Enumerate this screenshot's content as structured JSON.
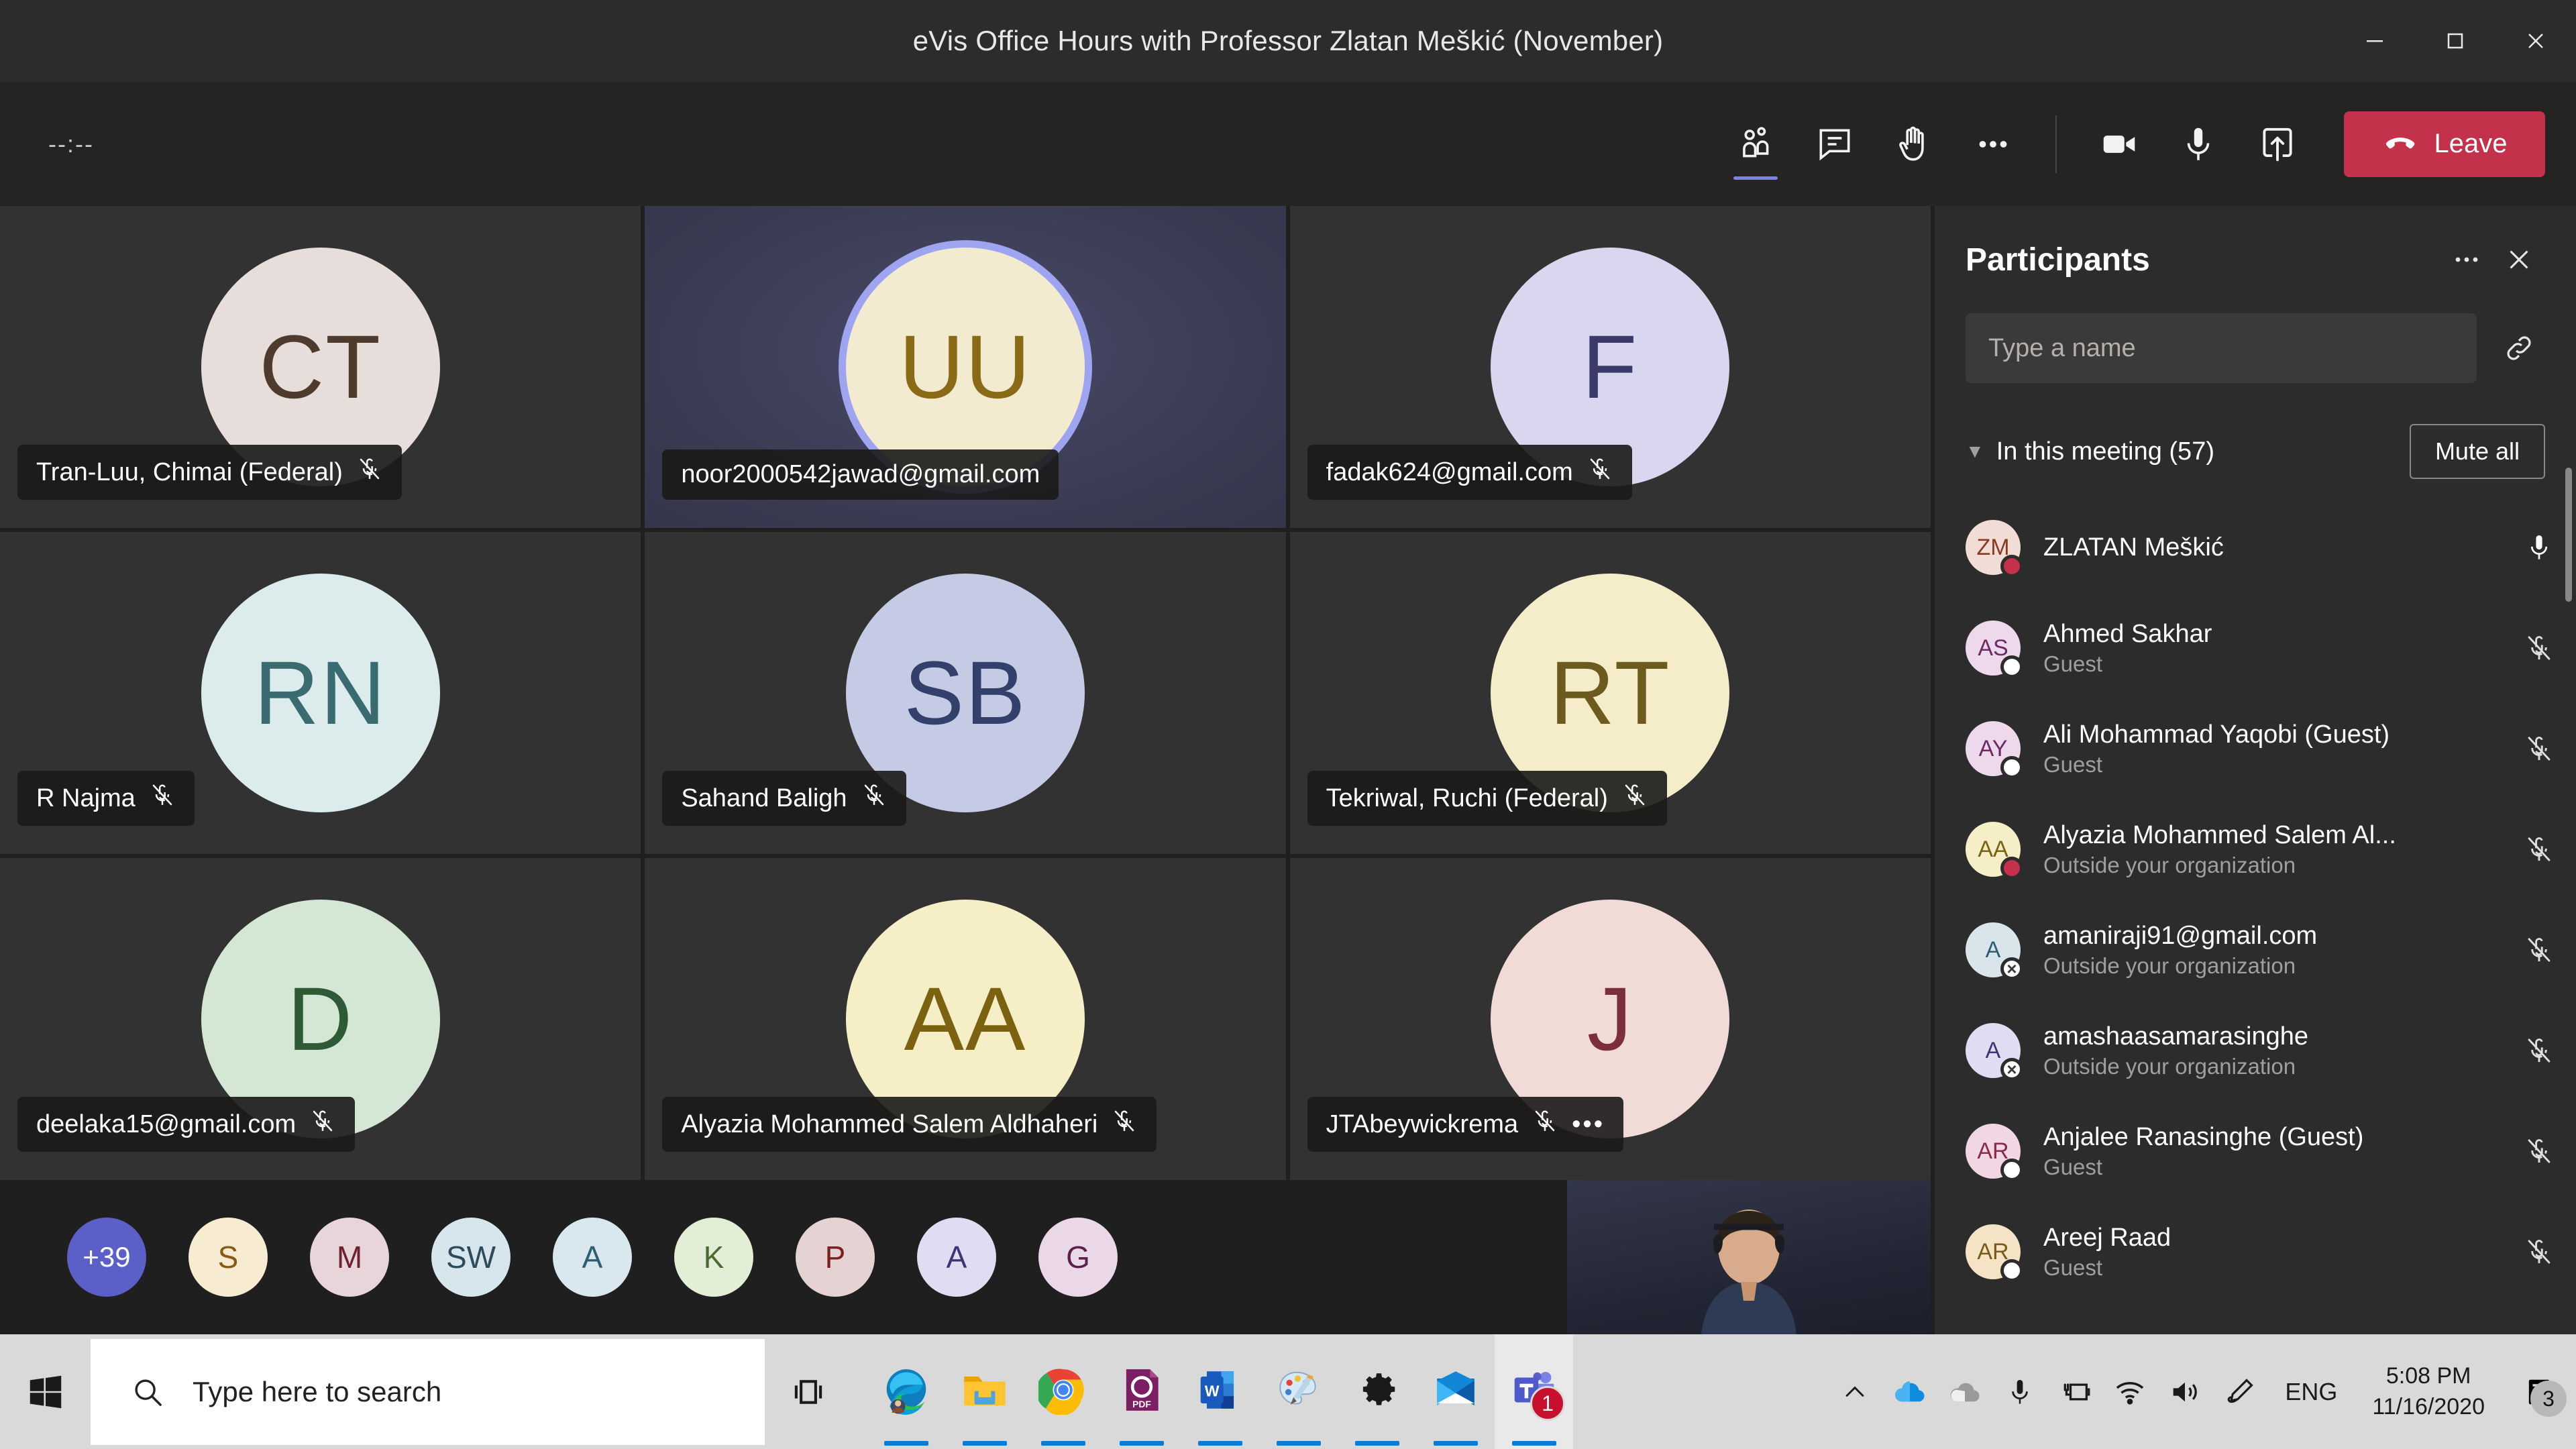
{
  "window": {
    "title": "eVis Office Hours with Professor Zlatan Meškić (November)",
    "minimize_label": "Minimize",
    "maximize_label": "Maximize",
    "close_label": "Close"
  },
  "toolbar": {
    "timer": "--:--",
    "people_label": "Show participants",
    "chat_label": "Show conversation",
    "raise_hand_label": "Raise your hand",
    "more_label": "More actions",
    "camera_label": "Turn camera on",
    "mic_label": "Mute",
    "share_label": "Share content",
    "leave_label": "Leave"
  },
  "stage": {
    "tiles": [
      {
        "initials": "CT",
        "name": "Tran-Luu, Chimai (Federal)",
        "bg": "#e7dedb",
        "fg": "#4f3a2e",
        "muted": true,
        "speaking": false,
        "more": false
      },
      {
        "initials": "UU",
        "name": "noor2000542jawad@gmail.com",
        "bg": "#f2ebd0",
        "fg": "#8a6a16",
        "muted": false,
        "speaking": true,
        "more": false
      },
      {
        "initials": "F",
        "name": "fadak624@gmail.com",
        "bg": "#d8d7ef",
        "fg": "#3b3b6b",
        "muted": true,
        "speaking": false,
        "more": false
      },
      {
        "initials": "RN",
        "name": "R Najma",
        "bg": "#dcebec",
        "fg": "#3a6b70",
        "muted": true,
        "speaking": false,
        "more": false
      },
      {
        "initials": "SB",
        "name": "Sahand Baligh",
        "bg": "#c6cbe5",
        "fg": "#33406b",
        "muted": true,
        "speaking": false,
        "more": false
      },
      {
        "initials": "RT",
        "name": "Tekriwal, Ruchi (Federal)",
        "bg": "#f5ecc9",
        "fg": "#6d5a1e",
        "muted": true,
        "speaking": false,
        "more": false
      },
      {
        "initials": "D",
        "name": "deelaka15@gmail.com",
        "bg": "#d4e6d4",
        "fg": "#2f5a36",
        "muted": true,
        "speaking": false,
        "more": false
      },
      {
        "initials": "AA",
        "name": "Alyazia Mohammed Salem Aldhaheri",
        "bg": "#f6eec6",
        "fg": "#7a6210",
        "muted": true,
        "speaking": false,
        "more": false
      },
      {
        "initials": "J",
        "name": "JTAbeywickrema",
        "bg": "#f0dbd7",
        "fg": "#7b2f3a",
        "muted": true,
        "speaking": false,
        "more": true
      }
    ],
    "overflow": [
      {
        "initials": "+39",
        "bg": "#5b5fc7",
        "fg": "#ffffff",
        "more": true
      },
      {
        "initials": "S",
        "bg": "#f7ebd2",
        "fg": "#8a5a14",
        "more": false
      },
      {
        "initials": "M",
        "bg": "#e7d5da",
        "fg": "#6e2230",
        "more": false
      },
      {
        "initials": "SW",
        "bg": "#d7e5ec",
        "fg": "#2f4a58",
        "more": false
      },
      {
        "initials": "A",
        "bg": "#d9e8ef",
        "fg": "#2f5d72",
        "more": false
      },
      {
        "initials": "K",
        "bg": "#e2eed6",
        "fg": "#4c6b32",
        "more": false
      },
      {
        "initials": "P",
        "bg": "#e5d3d3",
        "fg": "#7b2020",
        "more": false
      },
      {
        "initials": "A",
        "bg": "#e0dcf1",
        "fg": "#3d3576",
        "more": false
      },
      {
        "initials": "G",
        "bg": "#ead7e7",
        "fg": "#5d1f4b",
        "more": false
      }
    ],
    "selfview_label": "Your video"
  },
  "panel": {
    "title": "Participants",
    "more_label": "More options",
    "close_label": "Close participants pane",
    "search_placeholder": "Type a name",
    "search_value": "",
    "invite_link_label": "Share invite link",
    "section_label": "In this meeting (57)",
    "mute_all_label": "Mute all",
    "participants": [
      {
        "initials": "ZM",
        "name": "ZLATAN Meškić",
        "sub": "",
        "bg": "#f2ddd6",
        "fg": "#8a3a22",
        "presence": "busy",
        "muted": false
      },
      {
        "initials": "AS",
        "name": "Ahmed Sakhar",
        "sub": "Guest",
        "bg": "#eed9ec",
        "fg": "#6b2a63",
        "presence": "away",
        "muted": true
      },
      {
        "initials": "AY",
        "name": "Ali Mohammad Yaqobi (Guest)",
        "sub": "Guest",
        "bg": "#eed9ec",
        "fg": "#6b2a63",
        "presence": "away",
        "muted": true
      },
      {
        "initials": "AA",
        "name": "Alyazia Mohammed Salem Al...",
        "sub": "Outside your organization",
        "bg": "#f6eec6",
        "fg": "#7a6210",
        "presence": "busy",
        "muted": true
      },
      {
        "initials": "A",
        "name": "amaniraji91@gmail.com",
        "sub": "Outside your organization",
        "bg": "#d9e5ea",
        "fg": "#2f5d72",
        "presence": "offline",
        "muted": true
      },
      {
        "initials": "A",
        "name": "amashaasamarasinghe",
        "sub": "Outside your organization",
        "bg": "#e0dcf1",
        "fg": "#3d3576",
        "presence": "offline",
        "muted": true
      },
      {
        "initials": "AR",
        "name": "Anjalee Ranasinghe (Guest)",
        "sub": "Guest",
        "bg": "#f0d7e3",
        "fg": "#8a2a4b",
        "presence": "away",
        "muted": true
      },
      {
        "initials": "AR",
        "name": "Areej Raad",
        "sub": "Guest",
        "bg": "#f5e3c6",
        "fg": "#7a5a1a",
        "presence": "away",
        "muted": true
      }
    ]
  },
  "taskbar": {
    "start_label": "Start",
    "search_placeholder": "Type here to search",
    "task_view_label": "Task view",
    "apps": [
      {
        "name": "Microsoft Edge",
        "running": true,
        "focused": false,
        "badge": ""
      },
      {
        "name": "File Explorer",
        "running": true,
        "focused": false,
        "badge": ""
      },
      {
        "name": "Google Chrome",
        "running": true,
        "focused": false,
        "badge": ""
      },
      {
        "name": "Foxit PDF Reader",
        "running": true,
        "focused": false,
        "badge": ""
      },
      {
        "name": "Microsoft Word",
        "running": true,
        "focused": false,
        "badge": ""
      },
      {
        "name": "Paint 3D",
        "running": true,
        "focused": false,
        "badge": ""
      },
      {
        "name": "Settings",
        "running": true,
        "focused": false,
        "badge": ""
      },
      {
        "name": "Mail",
        "running": true,
        "focused": false,
        "badge": ""
      },
      {
        "name": "Microsoft Teams",
        "running": true,
        "focused": true,
        "badge": "1"
      }
    ],
    "tray": {
      "show_hidden_label": "Show hidden icons",
      "onedrive_personal_label": "OneDrive",
      "onedrive_work_label": "OneDrive for Business",
      "mic_label": "Microphone in use",
      "battery_label": "Battery charging",
      "network_label": "Network",
      "volume_label": "Volume",
      "pen_label": "Windows Ink Workspace",
      "language": "ENG",
      "time": "5:08 PM",
      "date": "11/16/2020",
      "notification_count": "3"
    }
  }
}
